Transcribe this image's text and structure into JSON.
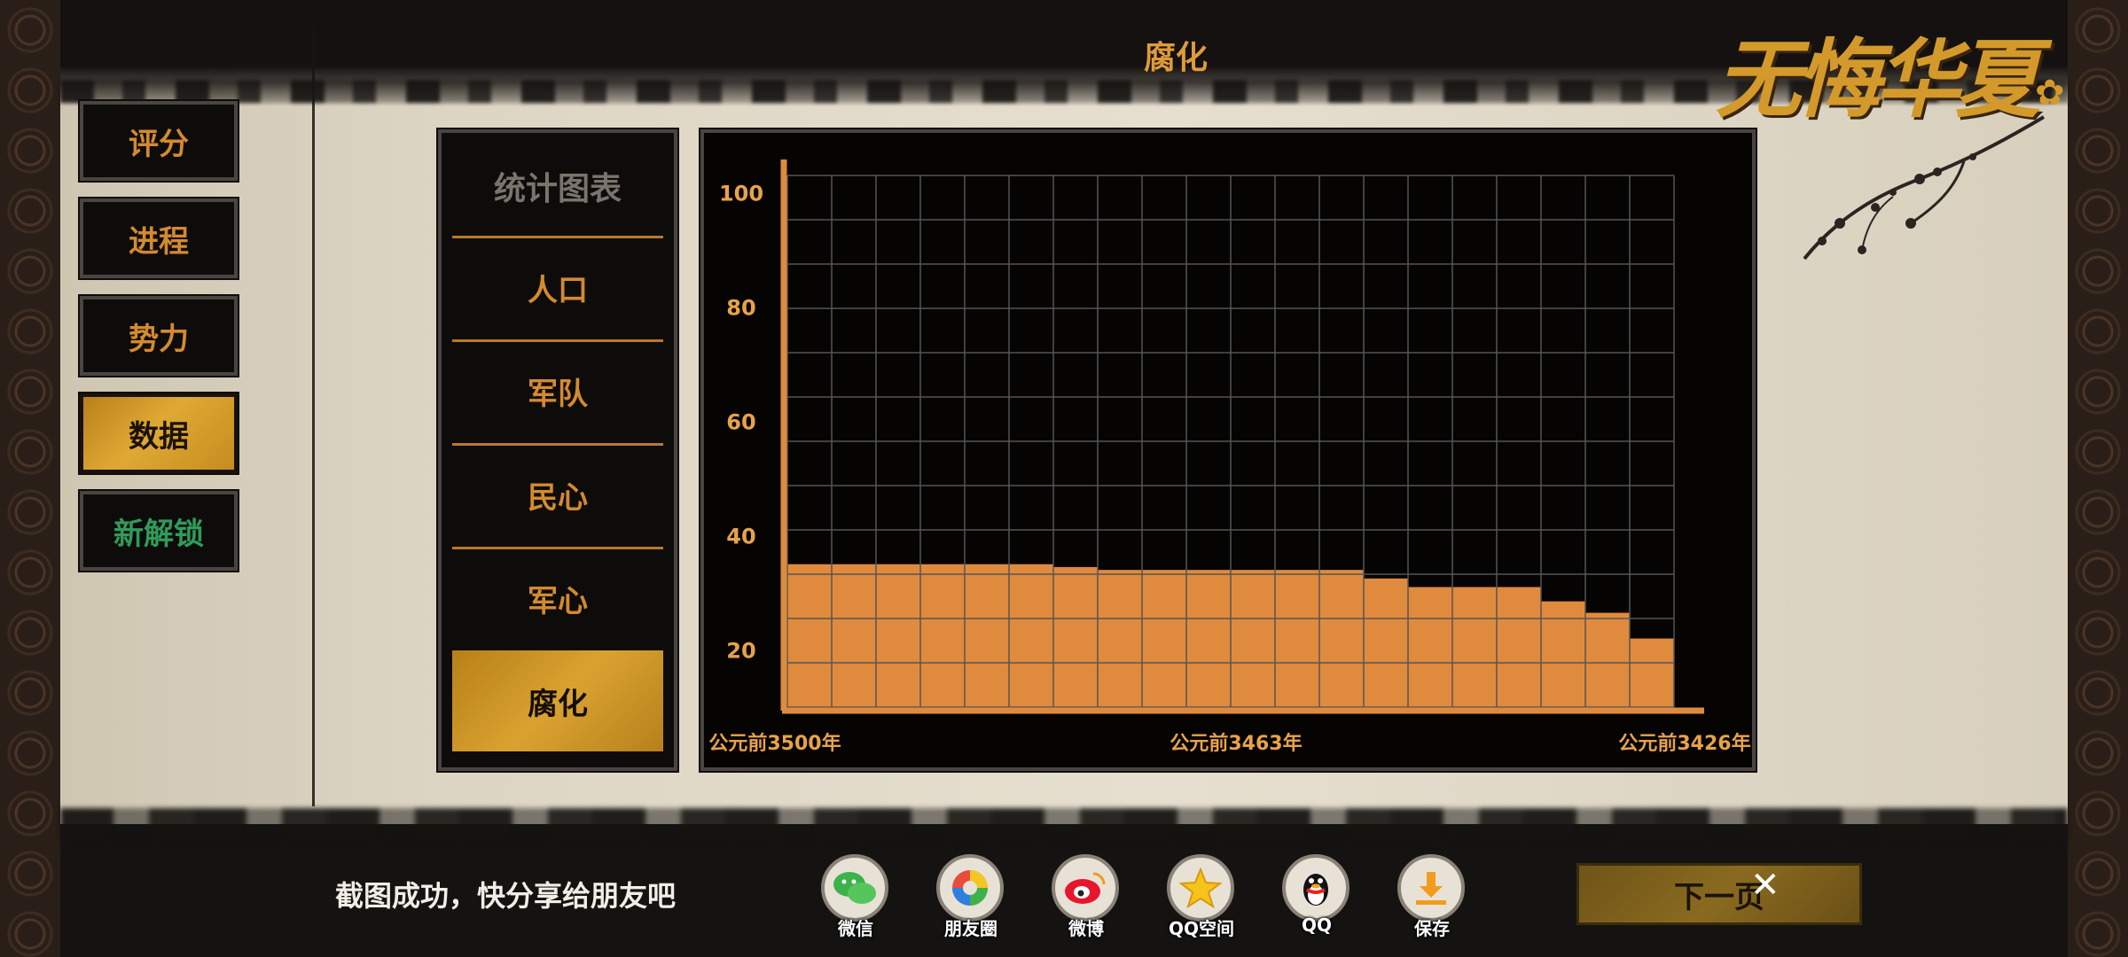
{
  "page_title": "腐化",
  "logo": {
    "text": "无悔华夏"
  },
  "nav": [
    {
      "label": "评分",
      "state": "normal"
    },
    {
      "label": "进程",
      "state": "normal"
    },
    {
      "label": "势力",
      "state": "normal"
    },
    {
      "label": "数据",
      "state": "active"
    },
    {
      "label": "新解锁",
      "state": "highlight-green"
    }
  ],
  "categories": {
    "header": "统计图表",
    "items": [
      {
        "label": "人口"
      },
      {
        "label": "军队"
      },
      {
        "label": "民心"
      },
      {
        "label": "军心"
      },
      {
        "label": "腐化",
        "active": true
      }
    ]
  },
  "chart_data": {
    "type": "bar",
    "title": "",
    "ylim": [
      10,
      103
    ],
    "yticks": [
      100,
      80,
      60,
      40,
      20
    ],
    "x_tick_labels": [
      "公元前3500年",
      "公元前3463年",
      "公元前3426年"
    ],
    "values": [
      35,
      35,
      35,
      35,
      35,
      35,
      34.5,
      34,
      34,
      34,
      34,
      34,
      34,
      32.5,
      31,
      31,
      31,
      28.5,
      26.5,
      22
    ],
    "grid": true,
    "colors": {
      "bar": "#e08a3e",
      "grid": "#555555",
      "axis": "#e08a3e",
      "tick_text": "#e8a24a"
    }
  },
  "share": {
    "message": "截图成功，快分享给朋友吧",
    "items": [
      {
        "label": "微信",
        "icon": "wechat-icon"
      },
      {
        "label": "朋友圈",
        "icon": "moments-icon"
      },
      {
        "label": "微博",
        "icon": "weibo-icon"
      },
      {
        "label": "QQ空间",
        "icon": "qzone-icon"
      },
      {
        "label": "QQ",
        "icon": "qq-icon"
      },
      {
        "label": "保存",
        "icon": "download-icon"
      }
    ],
    "next_label": "下一页",
    "close_symbol": "✕"
  }
}
